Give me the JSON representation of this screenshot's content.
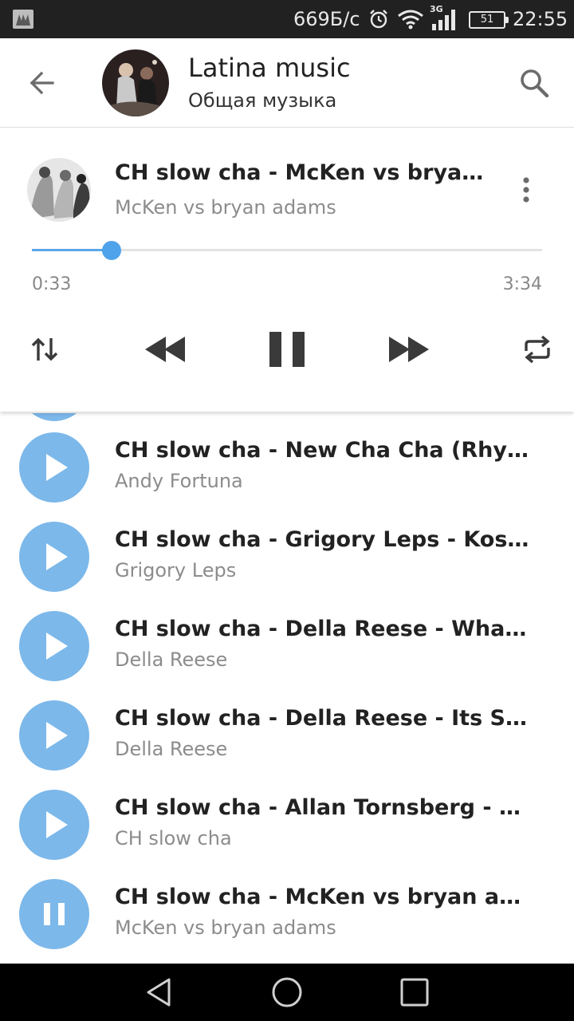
{
  "status_bar": {
    "speed": "669Б/с",
    "net_type": "3G",
    "battery": "51",
    "time": "22:55",
    "icons": [
      "app-icon",
      "alarm-icon",
      "wifi-icon",
      "signal-icon",
      "battery-icon"
    ]
  },
  "header": {
    "title": "Latina music",
    "subtitle": "Общая музыка",
    "icons": [
      "back-arrow-icon",
      "search-icon"
    ]
  },
  "player": {
    "title": "CH slow cha -  McKen vs bryan adams",
    "artist": "McKen vs bryan adams",
    "current_time": "0:33",
    "total_time": "3:34",
    "progress": 0.156,
    "accent_color": "#4ea3ea",
    "icons": [
      "more-vertical-icon",
      "shuffle-icon",
      "rewind-icon",
      "pause-icon",
      "fast-forward-icon",
      "repeat-icon"
    ]
  },
  "tracks": [
    {
      "title": "CH slow cha - New Cha Cha (Rhythm of the Night)",
      "artist": "Andy Fortuna",
      "state": "play"
    },
    {
      "title": "CH slow cha - Grigory Leps - Koshki",
      "artist": "Grigory Leps",
      "state": "play"
    },
    {
      "title": "CH slow cha - Della Reese - Whatever Lola Wants",
      "artist": "Della Reese",
      "state": "play"
    },
    {
      "title": "CH slow cha - Della Reese - Its So Nice",
      "artist": "Della Reese",
      "state": "play"
    },
    {
      "title": "CH slow cha - Allan Tornsberg - Cha Cha",
      "artist": "CH slow cha",
      "state": "play"
    },
    {
      "title": "CH slow cha -  McKen vs bryan adams",
      "artist": "McKen vs bryan adams",
      "state": "pause"
    }
  ],
  "list_button_color": "#7cb8ea",
  "nav_bar": {
    "icons": [
      "back-triangle-icon",
      "home-circle-icon",
      "recents-square-icon"
    ]
  }
}
